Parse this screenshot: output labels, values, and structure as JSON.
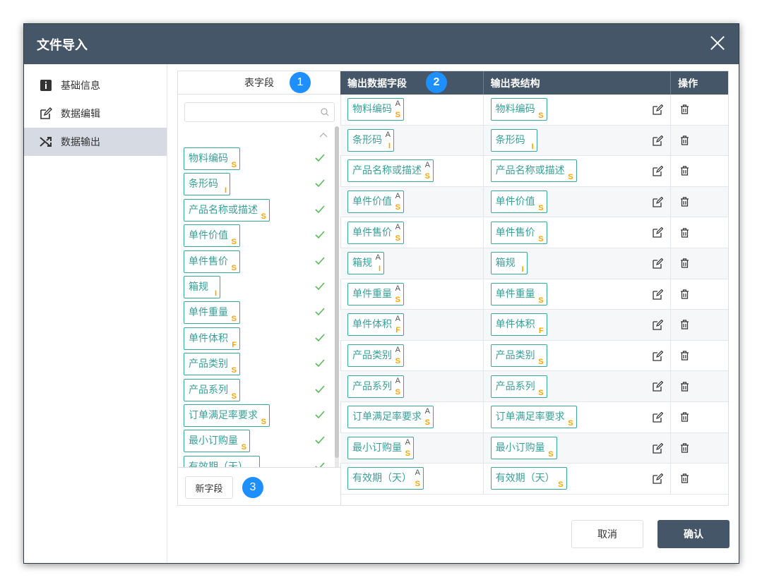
{
  "dialog": {
    "title": "文件导入"
  },
  "nav": [
    {
      "label": "基础信息",
      "icon": "info-icon"
    },
    {
      "label": "数据编辑",
      "icon": "edit-icon"
    },
    {
      "label": "数据输出",
      "icon": "shuffle-icon",
      "active": true
    }
  ],
  "left_panel": {
    "header": "表字段",
    "badge": "1",
    "search_value": "",
    "fields": [
      {
        "name": "物料编码",
        "type": "S"
      },
      {
        "name": "条形码",
        "type": "I"
      },
      {
        "name": "产品名称或描述",
        "type": "S"
      },
      {
        "name": "单件价值",
        "type": "S"
      },
      {
        "name": "单件售价",
        "type": "S"
      },
      {
        "name": "箱规",
        "type": "I"
      },
      {
        "name": "单件重量",
        "type": "S"
      },
      {
        "name": "单件体积",
        "type": "F"
      },
      {
        "name": "产品类别",
        "type": "S"
      },
      {
        "name": "产品系列",
        "type": "S"
      },
      {
        "name": "订单满足率要求",
        "type": "S"
      },
      {
        "name": "最小订购量",
        "type": "S"
      },
      {
        "name": "有效期（天）",
        "type": "S"
      }
    ],
    "new_field_button": "新字段",
    "footer_badge": "3"
  },
  "table": {
    "headers": [
      "输出数据字段",
      "输出表结构",
      "操作"
    ],
    "header_badge": "2",
    "marker_A": "A",
    "rows": [
      {
        "output_field": "物料编码",
        "type": "S",
        "structure": "物料编码"
      },
      {
        "output_field": "条形码",
        "type": "I",
        "structure": "条形码"
      },
      {
        "output_field": "产品名称或描述",
        "type": "S",
        "structure": "产品名称或描述"
      },
      {
        "output_field": "单件价值",
        "type": "S",
        "structure": "单件价值"
      },
      {
        "output_field": "单件售价",
        "type": "S",
        "structure": "单件售价"
      },
      {
        "output_field": "箱规",
        "type": "I",
        "structure": "箱规"
      },
      {
        "output_field": "单件重量",
        "type": "S",
        "structure": "单件重量"
      },
      {
        "output_field": "单件体积",
        "type": "F",
        "structure": "单件体积"
      },
      {
        "output_field": "产品类别",
        "type": "S",
        "structure": "产品类别"
      },
      {
        "output_field": "产品系列",
        "type": "S",
        "structure": "产品系列"
      },
      {
        "output_field": "订单满足率要求",
        "type": "S",
        "structure": "订单满足率要求"
      },
      {
        "output_field": "最小订购量",
        "type": "S",
        "structure": "最小订购量"
      },
      {
        "output_field": "有效期（天）",
        "type": "S",
        "structure": "有效期（天）"
      }
    ]
  },
  "buttons": {
    "cancel": "取消",
    "confirm": "确认"
  },
  "colors": {
    "header_bg": "#455668",
    "chip_border": "#3aa6a0",
    "type_tag": "#f5a700",
    "check": "#5cb85c",
    "badge": "#1e8fff"
  }
}
